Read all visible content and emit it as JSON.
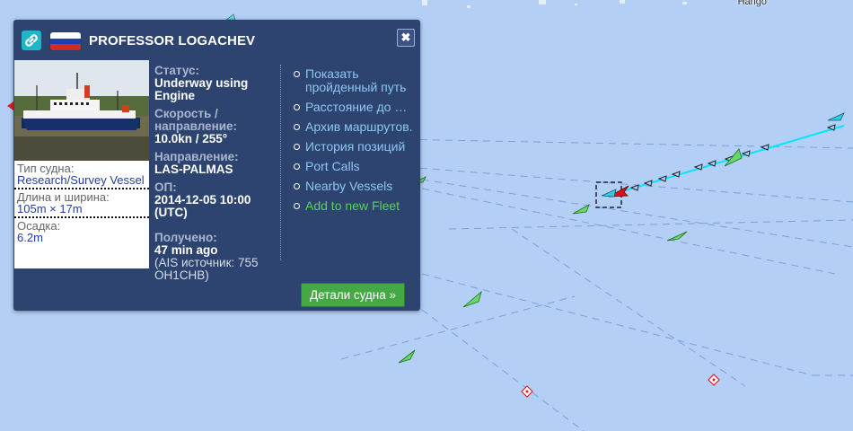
{
  "map": {
    "place_label": "Hango"
  },
  "popup": {
    "ship_name": "PROFESSOR LOGACHEV",
    "flag_colors": [
      "#ffffff",
      "#1f3fb0",
      "#d52b1e"
    ],
    "close_label": "✖",
    "vessel_specs": [
      {
        "label": "Тип судна:",
        "value": "Research/Survey Vessel"
      },
      {
        "label": "Длина и ширина:",
        "value": "105m × 17m"
      },
      {
        "label": "Осадка:",
        "value": "6.2m"
      }
    ],
    "status": {
      "label": "Статус:",
      "value": "Underway using Engine"
    },
    "speed": {
      "label": "Скорость / направление:",
      "value": "10.0kn / 255°"
    },
    "destination": {
      "label": "Направление:",
      "value": "LAS-PALMAS"
    },
    "eta": {
      "label": "ОП:",
      "value": "2014-12-05 10:00 (UTC)"
    },
    "received": {
      "label": "Получено:",
      "value": "47 min ago",
      "source": "(AIS источник: 755 OH1CHB)"
    },
    "links": [
      "Показать пройденный путь",
      "Расстояние до …",
      "Архив маршрутов.",
      "История позиций",
      "Port Calls",
      "Nearby Vessels",
      "Add to new Fleet"
    ],
    "details_button": "Детали судна »"
  },
  "colors": {
    "popup_bg": "#2d4370",
    "link": "#8ec7f2",
    "fleet_link": "#57d25a",
    "button": "#46a845",
    "map_sea": "#b4cff5",
    "track": "#00e5ff"
  }
}
